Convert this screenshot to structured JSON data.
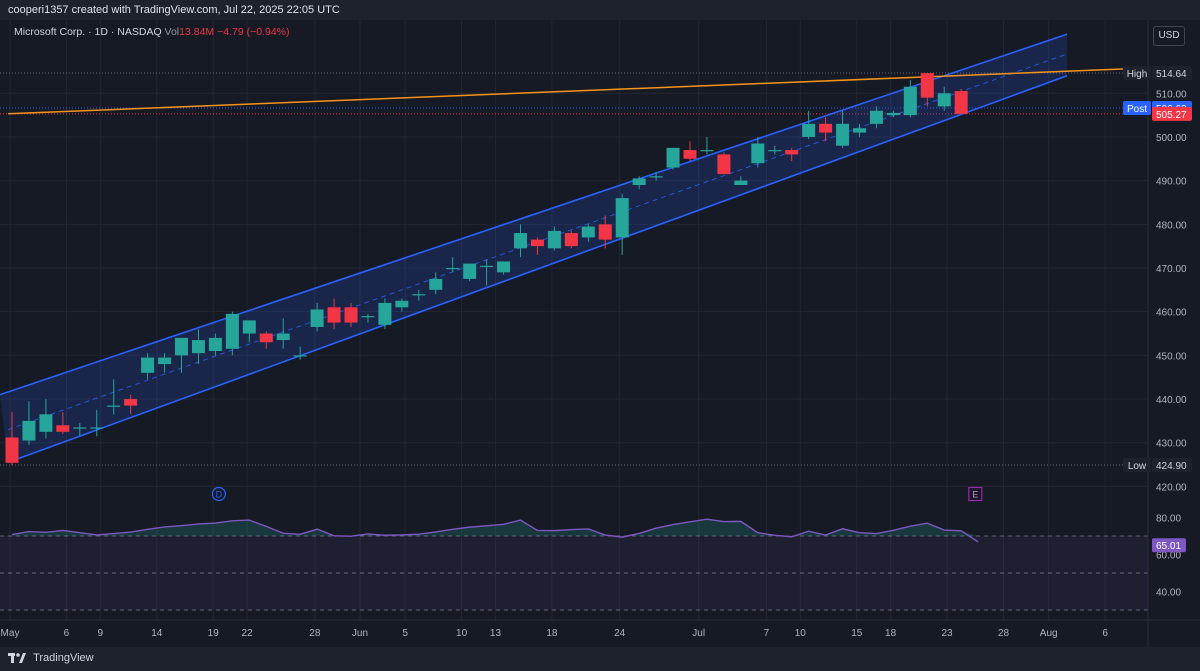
{
  "header": {
    "attribution": "cooperi1357 created with TradingView.com, Jul 22, 2025 22:05 UTC"
  },
  "legend": {
    "symbol": "Microsoft Corp. · 1D · NASDAQ",
    "vol_label": "Vol",
    "vol_value": "13.84M",
    "change": "−4.79 (−0.94%)"
  },
  "currency": "USD",
  "footer": {
    "brand": "TradingView"
  },
  "colors": {
    "up": "#26a69a",
    "down": "#f23645",
    "channel": "#2962ff",
    "resistance": "#f7931a",
    "rsi": "#7e57c2",
    "bg": "#161a25"
  },
  "chart_data": {
    "type": "candlestick",
    "ylim": [
      415,
      523
    ],
    "price_ticks": [
      420,
      430,
      440,
      450,
      460,
      470,
      480,
      490,
      500,
      510
    ],
    "x_ticks": [
      {
        "label": "May",
        "day": 1
      },
      {
        "label": "6",
        "day": 6
      },
      {
        "label": "9",
        "day": 9
      },
      {
        "label": "14",
        "day": 14
      },
      {
        "label": "19",
        "day": 19
      },
      {
        "label": "22",
        "day": 22
      },
      {
        "label": "28",
        "day": 28
      },
      {
        "label": "Jun",
        "day": 32
      },
      {
        "label": "5",
        "day": 36
      },
      {
        "label": "10",
        "day": 41
      },
      {
        "label": "13",
        "day": 44
      },
      {
        "label": "18",
        "day": 49
      },
      {
        "label": "24",
        "day": 55
      },
      {
        "label": "Jul",
        "day": 62
      },
      {
        "label": "7",
        "day": 68
      },
      {
        "label": "10",
        "day": 71
      },
      {
        "label": "15",
        "day": 76
      },
      {
        "label": "18",
        "day": 79
      },
      {
        "label": "23",
        "day": 84
      },
      {
        "label": "28",
        "day": 89
      },
      {
        "label": "Aug",
        "day": 93
      },
      {
        "label": "6",
        "day": 98
      }
    ],
    "candles": [
      {
        "o": 431.2,
        "h": 437,
        "l": 424.9,
        "c": 425.4
      },
      {
        "o": 430.5,
        "h": 439.5,
        "l": 429.5,
        "c": 435
      },
      {
        "o": 432.5,
        "h": 440,
        "l": 431,
        "c": 436.5
      },
      {
        "o": 434,
        "h": 437,
        "l": 432,
        "c": 432.5
      },
      {
        "o": 433.5,
        "h": 434.5,
        "l": 431.5,
        "c": 433.5
      },
      {
        "o": 433.5,
        "h": 437.5,
        "l": 431.5,
        "c": 433.5
      },
      {
        "o": 438.5,
        "h": 444.5,
        "l": 436.5,
        "c": 438.5
      },
      {
        "o": 440,
        "h": 441,
        "l": 436.5,
        "c": 438.5
      },
      {
        "o": 446,
        "h": 450.5,
        "l": 444.5,
        "c": 449.5
      },
      {
        "o": 448,
        "h": 450.5,
        "l": 446,
        "c": 449.5
      },
      {
        "o": 450,
        "h": 453,
        "l": 446,
        "c": 454
      },
      {
        "o": 450.5,
        "h": 456,
        "l": 448,
        "c": 453.5
      },
      {
        "o": 451,
        "h": 455,
        "l": 450,
        "c": 454
      },
      {
        "o": 451.5,
        "h": 460,
        "l": 450,
        "c": 459.5
      },
      {
        "o": 455,
        "h": 458,
        "l": 453,
        "c": 458
      },
      {
        "o": 455,
        "h": 455.5,
        "l": 451.5,
        "c": 453
      },
      {
        "o": 453.5,
        "h": 458.5,
        "l": 451.5,
        "c": 455
      },
      {
        "o": 450,
        "h": 452,
        "l": 449,
        "c": 450
      },
      {
        "o": 456.5,
        "h": 462,
        "l": 455.5,
        "c": 460.5
      },
      {
        "o": 461,
        "h": 463,
        "l": 456,
        "c": 457.5
      },
      {
        "o": 461,
        "h": 462,
        "l": 456.5,
        "c": 457.5
      },
      {
        "o": 459,
        "h": 459.5,
        "l": 457.5,
        "c": 459
      },
      {
        "o": 457,
        "h": 463,
        "l": 456,
        "c": 462
      },
      {
        "o": 461,
        "h": 463,
        "l": 460,
        "c": 462.5
      },
      {
        "o": 464,
        "h": 465,
        "l": 462.5,
        "c": 464
      },
      {
        "o": 465,
        "h": 469,
        "l": 464,
        "c": 467.5
      },
      {
        "o": 470,
        "h": 472.5,
        "l": 469,
        "c": 470
      },
      {
        "o": 467.5,
        "h": 471,
        "l": 467,
        "c": 471
      },
      {
        "o": 470.5,
        "h": 472,
        "l": 466,
        "c": 470.5
      },
      {
        "o": 469,
        "h": 471.5,
        "l": 468.5,
        "c": 471.5
      },
      {
        "o": 474.5,
        "h": 480,
        "l": 472.5,
        "c": 478
      },
      {
        "o": 476.5,
        "h": 477,
        "l": 473,
        "c": 475
      },
      {
        "o": 474.5,
        "h": 479.5,
        "l": 474,
        "c": 478.5
      },
      {
        "o": 478,
        "h": 478.5,
        "l": 474.5,
        "c": 475
      },
      {
        "o": 477,
        "h": 480,
        "l": 476,
        "c": 479.5
      },
      {
        "o": 480,
        "h": 482,
        "l": 474.5,
        "c": 476.5
      },
      {
        "o": 477,
        "h": 487,
        "l": 473,
        "c": 486
      },
      {
        "o": 489,
        "h": 491,
        "l": 488,
        "c": 490.5
      },
      {
        "o": 491,
        "h": 492,
        "l": 490,
        "c": 491
      },
      {
        "o": 493,
        "h": 497.5,
        "l": 492.5,
        "c": 497.5
      },
      {
        "o": 497,
        "h": 499,
        "l": 494.5,
        "c": 495
      },
      {
        "o": 497,
        "h": 500,
        "l": 496,
        "c": 497
      },
      {
        "o": 496,
        "h": 496.5,
        "l": 491.5,
        "c": 491.5
      },
      {
        "o": 489,
        "h": 491,
        "l": 489,
        "c": 490
      },
      {
        "o": 494,
        "h": 500,
        "l": 493,
        "c": 498.5
      },
      {
        "o": 497,
        "h": 498,
        "l": 496,
        "c": 497
      },
      {
        "o": 497,
        "h": 497.5,
        "l": 494.5,
        "c": 496
      },
      {
        "o": 500,
        "h": 506,
        "l": 499.5,
        "c": 503
      },
      {
        "o": 503,
        "h": 504.5,
        "l": 499,
        "c": 501
      },
      {
        "o": 498,
        "h": 506,
        "l": 497.5,
        "c": 503
      },
      {
        "o": 501,
        "h": 503,
        "l": 500,
        "c": 502
      },
      {
        "o": 503,
        "h": 507,
        "l": 502,
        "c": 506
      },
      {
        "o": 505,
        "h": 506,
        "l": 504.5,
        "c": 505.5
      },
      {
        "o": 505,
        "h": 513,
        "l": 504.5,
        "c": 511.5
      },
      {
        "o": 514.6,
        "h": 514.64,
        "l": 507,
        "c": 509
      },
      {
        "o": 507,
        "h": 511.5,
        "l": 506,
        "c": 510
      },
      {
        "o": 510.5,
        "h": 511,
        "l": 505.3,
        "c": 505.27
      }
    ],
    "channel": {
      "upper": {
        "x1": 0,
        "y1": 441,
        "x2": 1067,
        "y2": 523.5
      },
      "lower": {
        "x1": 8,
        "y1": 425.5,
        "x2": 1067,
        "y2": 514
      },
      "mid": {
        "x1": 8,
        "y1": 433,
        "x2": 1067,
        "y2": 519
      }
    },
    "resistance": {
      "x1": 8,
      "y1": 505.3,
      "x2": 1148,
      "y2": 515.8
    },
    "labels": {
      "high": {
        "name": "High",
        "value": "514.64",
        "price": 514.64
      },
      "post": {
        "name": "Post",
        "value": "506.63",
        "price": 506.63
      },
      "last": {
        "value": "505.27",
        "price": 505.27
      },
      "low": {
        "name": "Low",
        "value": "424.90",
        "price": 424.9
      }
    },
    "event_markers": [
      {
        "label": "D",
        "day": 19.5
      },
      {
        "label": "E",
        "day": 86.5
      }
    ],
    "rsi": {
      "ylim": [
        33,
        86
      ],
      "ticks": [
        40,
        60,
        80
      ],
      "bands": [
        70,
        50,
        30
      ],
      "current": "65.01",
      "current_value": 65.01,
      "values": [
        70.8,
        72.4,
        72.0,
        73.0,
        71.8,
        70.6,
        71.3,
        72.1,
        73.6,
        74.9,
        75.6,
        76.5,
        77.0,
        78.2,
        78.6,
        75.2,
        71.5,
        70.9,
        73.7,
        70.1,
        69.9,
        71.1,
        70.4,
        70.6,
        71.0,
        72.2,
        73.6,
        74.8,
        75.5,
        76.3,
        78.6,
        73.0,
        72.9,
        73.5,
        73.8,
        70.5,
        69.4,
        71.4,
        74.2,
        76.2,
        77.7,
        79.1,
        77.8,
        77.9,
        71.8,
        70.4,
        69.6,
        72.6,
        70.5,
        73.9,
        71.8,
        71.3,
        73.1,
        75.3,
        76.9,
        73.2,
        72.8,
        66.8
      ]
    }
  }
}
